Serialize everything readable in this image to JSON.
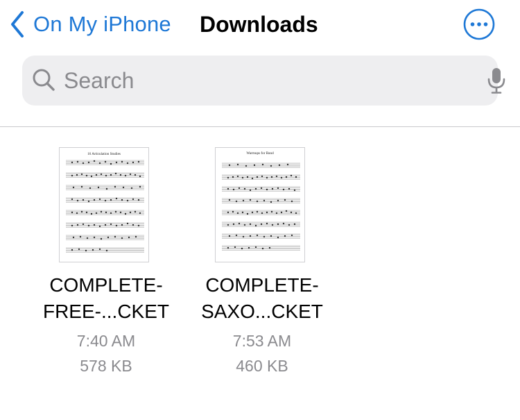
{
  "nav": {
    "back_label": "On My iPhone",
    "title": "Downloads",
    "accent_color": "#1e78d6"
  },
  "search": {
    "placeholder": "Search",
    "icon": "magnifier-icon",
    "mic_icon": "microphone-icon"
  },
  "files": [
    {
      "name_line1": "COMPLETE-",
      "name_line2": "FREE-...CKET",
      "time": "7:40 AM",
      "size": "578 KB",
      "thumbnail_title": "16 Articulation Studies"
    },
    {
      "name_line1": "COMPLETE-",
      "name_line2": "SAXO...CKET",
      "time": "7:53 AM",
      "size": "460 KB",
      "thumbnail_title": "Warmups for Band"
    }
  ]
}
